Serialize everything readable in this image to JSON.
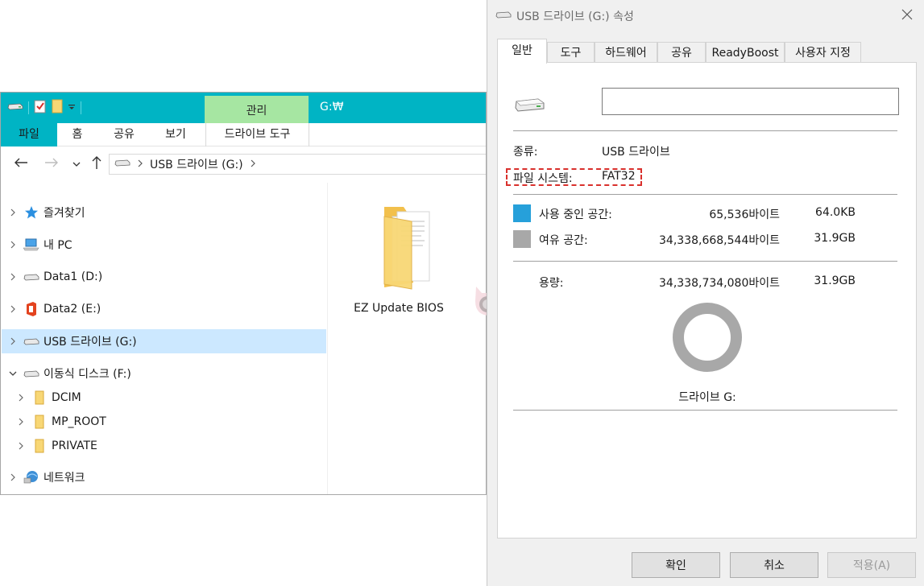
{
  "explorer": {
    "title_path": "G:₩",
    "manage_tab": "관리",
    "ribbon_tabs": [
      "파일",
      "홈",
      "공유",
      "보기",
      "드라이브 도구"
    ],
    "address": {
      "drive": "USB 드라이브 (G:)"
    },
    "tree": [
      {
        "label": "즐겨찾기",
        "icon": "star-icon",
        "expanded": false
      },
      {
        "label": "내 PC",
        "icon": "pc-icon",
        "expanded": false
      },
      {
        "label": "Data1 (D:)",
        "icon": "drive-icon",
        "expanded": false
      },
      {
        "label": "Data2 (E:)",
        "icon": "office-drive-icon",
        "expanded": false
      },
      {
        "label": "USB 드라이브 (G:)",
        "icon": "drive-icon",
        "expanded": false,
        "selected": true
      },
      {
        "label": "이동식 디스크 (F:)",
        "icon": "drive-icon",
        "expanded": true
      },
      {
        "label": "DCIM",
        "icon": "folder-icon"
      },
      {
        "label": "MP_ROOT",
        "icon": "folder-icon"
      },
      {
        "label": "PRIVATE",
        "icon": "folder-icon"
      },
      {
        "label": "네트워크",
        "icon": "network-icon",
        "expanded": false
      }
    ],
    "content": {
      "folder_name": "EZ Update BIOS"
    }
  },
  "properties": {
    "title": "USB 드라이브 (G:) 속성",
    "tabs": [
      "일반",
      "도구",
      "하드웨어",
      "공유",
      "ReadyBoost",
      "사용자 지정"
    ],
    "volume_name": "",
    "type_label": "종류:",
    "type_value": "USB 드라이브",
    "fs_label": "파일 시스템:",
    "fs_value": "FAT32",
    "used_label": "사용 중인 공간:",
    "used_bytes": "65,536바이트",
    "used_size": "64.0KB",
    "free_label": "여유 공간:",
    "free_bytes": "34,338,668,544바이트",
    "free_size": "31.9GB",
    "capacity_label": "용량:",
    "capacity_bytes": "34,338,734,080바이트",
    "capacity_size": "31.9GB",
    "drive_caption": "드라이브 G:",
    "used_fraction": 1.9e-06,
    "buttons": {
      "ok": "확인",
      "cancel": "취소",
      "apply": "적용(A)"
    },
    "colors": {
      "used": "#26a0da",
      "free": "#a8a8a8",
      "highlight": "#d9302c"
    }
  },
  "colors": {
    "titlebar": "#00b4c4",
    "manage_tab": "#a6e6a2",
    "selection": "#cce8ff"
  }
}
